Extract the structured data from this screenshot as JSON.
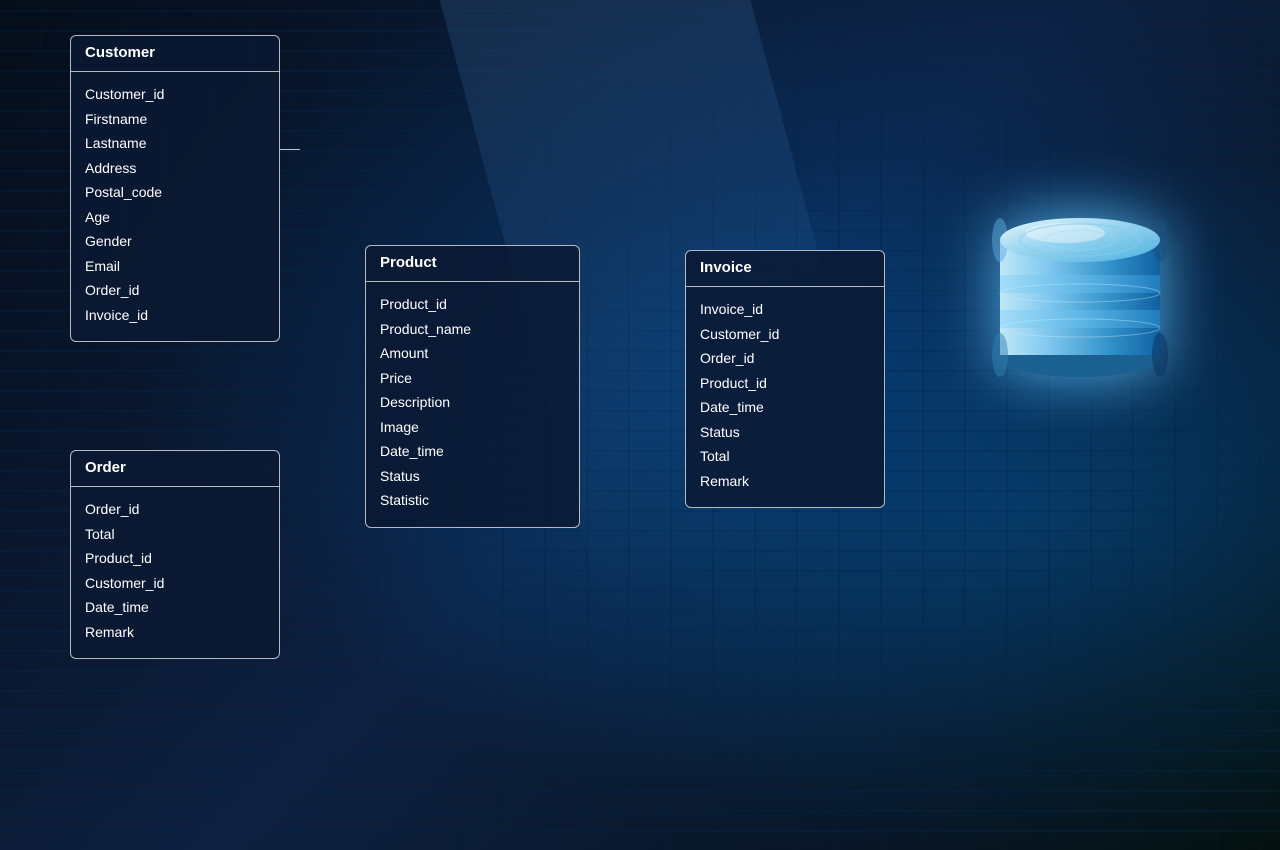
{
  "background": {
    "description": "Dark server room with blue lighting"
  },
  "entities": {
    "customer": {
      "title": "Customer",
      "fields": [
        "Customer_id",
        "Firstname",
        "Lastname",
        "Address",
        "Postal_code",
        "Age",
        "Gender",
        "Email",
        "Order_id",
        "Invoice_id"
      ]
    },
    "order": {
      "title": "Order",
      "fields": [
        "Order_id",
        "Total",
        "Product_id",
        "Customer_id",
        "Date_time",
        "Remark"
      ]
    },
    "product": {
      "title": "Product",
      "fields": [
        "Product_id",
        "Product_name",
        "Amount",
        "Price",
        "Description",
        "Image",
        "Date_time",
        "Status",
        "Statistic"
      ]
    },
    "invoice": {
      "title": "Invoice",
      "fields": [
        "Invoice_id",
        "Customer_id",
        "Order_id",
        "Product_id",
        "Date_time",
        "Status",
        "Total",
        "Remark"
      ]
    }
  },
  "database_icon": {
    "label": "Database"
  }
}
